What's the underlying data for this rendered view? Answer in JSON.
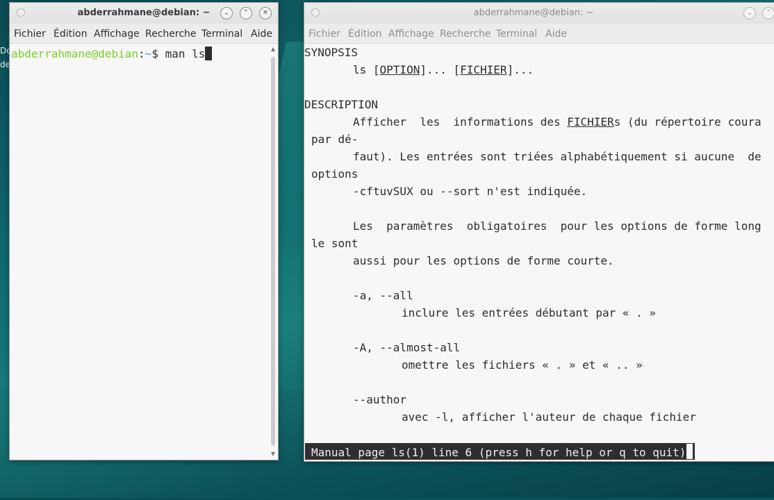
{
  "desktop": {
    "label_1": "Do",
    "label_2": "de"
  },
  "left_window": {
    "title": "abderrahmane@debian: ~",
    "menu": [
      "Fichier",
      "Édition",
      "Affichage",
      "Recherche",
      "Terminal",
      "Aide"
    ],
    "prompt_user": "abderrahmane@debian",
    "prompt_sep": ":",
    "prompt_path": "~",
    "prompt_symbol": "$ ",
    "command": "man ls"
  },
  "right_window": {
    "title": "abderrahmane@debian: ~",
    "menu": [
      "Fichier",
      "Édition",
      "Affichage",
      "Recherche",
      "Terminal",
      "Aide"
    ],
    "man": {
      "synopsis_heading": "SYNOPSIS",
      "synopsis_ls": "ls [",
      "synopsis_option": "OPTION",
      "synopsis_mid": "]... [",
      "synopsis_fichier": "FICHIER",
      "synopsis_end": "]...",
      "description_heading": "DESCRIPTION",
      "desc1_a": "Afficher  les  informations des ",
      "desc1_fichier": "FICHIER",
      "desc1_b": "s (du répertoire coura",
      "desc2": "par dé-",
      "desc3": "faut). Les entrées sont triées alphabétiquement si aucune  de",
      "desc4": "options",
      "desc5": "-cftuvSUX ou --sort n'est indiquée.",
      "param1": "Les  paramètres  obligatoires  pour les options de forme long",
      "param2": "le sont",
      "param3": "aussi pour les options de forme courte.",
      "opt_a": "-a, --all",
      "opt_a_desc": "inclure les entrées débutant par « . »",
      "opt_A": "-A, --almost-all",
      "opt_A_desc": "omettre les fichiers « . » et « .. »",
      "opt_author": "--author",
      "opt_author_desc": "avec -l, afficher l'auteur de chaque fichier"
    },
    "status": "Manual page ls(1) line 6 (press h for help or q to quit)"
  },
  "colors": {
    "prompt_user": "#7bd02a",
    "prompt_path": "#3aa0d8",
    "status_bg": "#2e2e2e"
  }
}
